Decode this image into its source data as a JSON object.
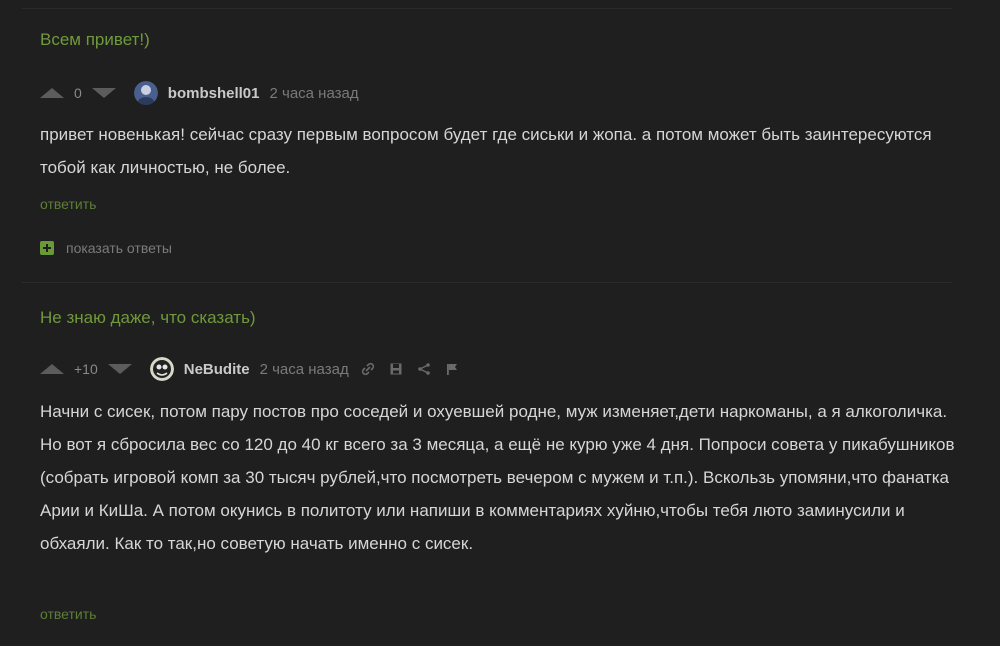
{
  "comments": [
    {
      "parent_excerpt": "Всем привет!)",
      "rating": "0",
      "username": "bombshell01",
      "time": "2 часа назад",
      "text": "привет новенькая! сейчас сразу первым вопросом будет где сиськи и жопа. а потом может быть заинтересуются тобой как личностью, не более.",
      "reply_label": "ответить",
      "show_replies_label": "показать ответы"
    },
    {
      "parent_excerpt": "Не знаю даже, что сказать)",
      "rating": "+10",
      "username": "NeBudite",
      "time": "2 часа назад",
      "text": "Начни с сисек, потом пару постов про соседей и охуевшей родне, муж изменяет,дети наркоманы, а я алкоголичка. Но вот я сбросила вес со 120 до 40 кг всего за 3 месяца, а ещё не курю уже 4 дня. Попроси совета у пикабушников (собрать игровой комп за 30 тысяч рублей,что посмотреть вечером с мужем и т.п.). Вскользь упомяни,что фанатка Арии и КиШа.  А потом окунись в политоту или напиши в комментариях хуйню,чтобы тебя люто заминусили и обхаяли. Как то так,но советую начать именно с сисек.",
      "reply_label": "ответить",
      "tools": [
        "link-icon",
        "save-icon",
        "share-icon",
        "flag-icon"
      ]
    }
  ],
  "colors": {
    "background": "#1f1f1f",
    "accent_green": "#6f9a3b",
    "text": "#d6d6d6",
    "muted": "#7a7a7a"
  }
}
